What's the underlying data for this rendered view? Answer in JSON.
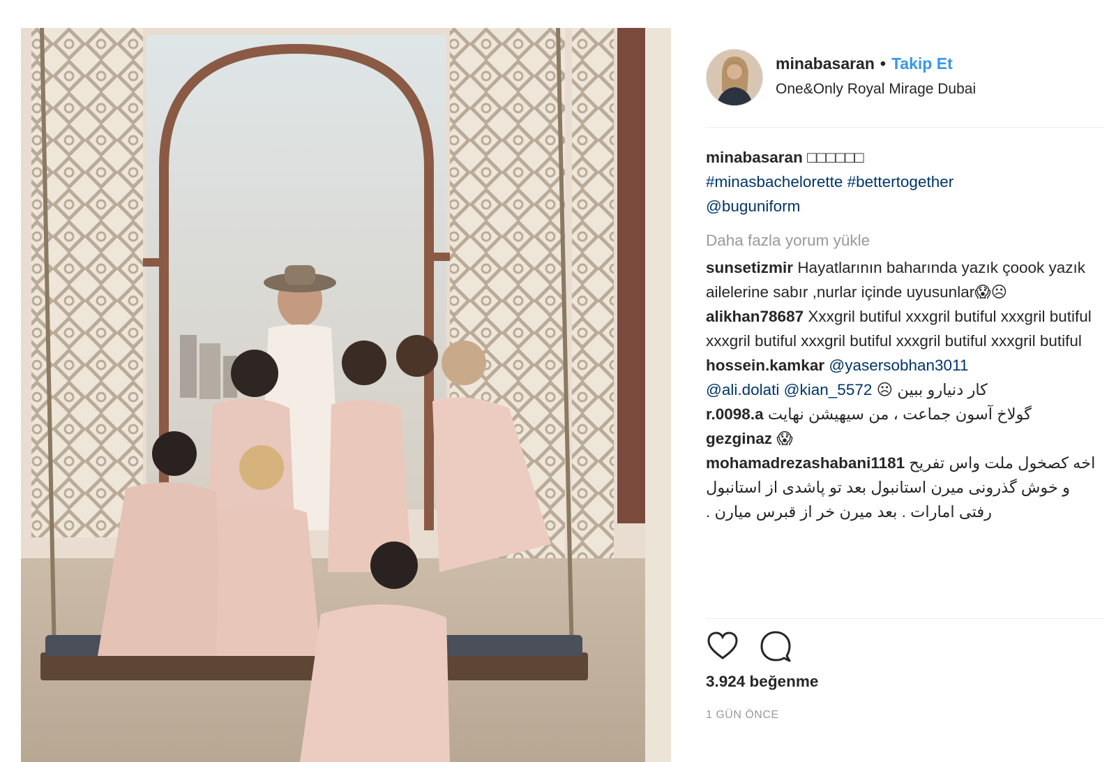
{
  "header": {
    "username": "minabasaran",
    "separator": "•",
    "follow_label": "Takip Et",
    "location": "One&Only Royal Mirage Dubai"
  },
  "caption": {
    "username": "minabasaran",
    "emoji": "□□□□□□",
    "hashtags": "#minasbachelorette #bettertogether",
    "mention": "@buguniform"
  },
  "load_more": "Daha fazla yorum yükle",
  "comments": [
    {
      "username": "sunsetizmir",
      "text": "Hayatlarının baharında yazık çoook yazık ailelerine sabır ,nurlar içinde uyusunlar😱☹"
    },
    {
      "username": "alikhan78687",
      "text": "Xxxgril butiful xxxgril butiful xxxgril butiful xxxgril butiful xxxgril butiful xxxgril butiful xxxgril butiful"
    },
    {
      "username": "hossein.kamkar",
      "mention1": "@yasersobhan3011",
      "mention2": "@ali.dolati",
      "mention3": "@kian_5572",
      "text": "کار دنیارو ببین ☹"
    },
    {
      "username": "r.0098.a",
      "text": "گولاخ آسون جماعت ، من سیهیشن نهایت"
    },
    {
      "username": "gezginaz",
      "text": "😱"
    },
    {
      "username": "mohamadrezashabani1181",
      "text": "اخه کصخول ملت واس تفریح و خوش گذرونی میرن استانبول بعد تو پاشدی از استانبول رفتی امارات . بعد میرن خر از قبرس میارن ."
    }
  ],
  "actions": {
    "like_icon": "heart-icon",
    "comment_icon": "comment-bubble-icon"
  },
  "likes_text": "3.924 beğenme",
  "time_text": "1 GÜN ÖNCE",
  "colors": {
    "link": "#3897f0",
    "tag": "#003569",
    "muted": "#999999",
    "text": "#262626"
  }
}
